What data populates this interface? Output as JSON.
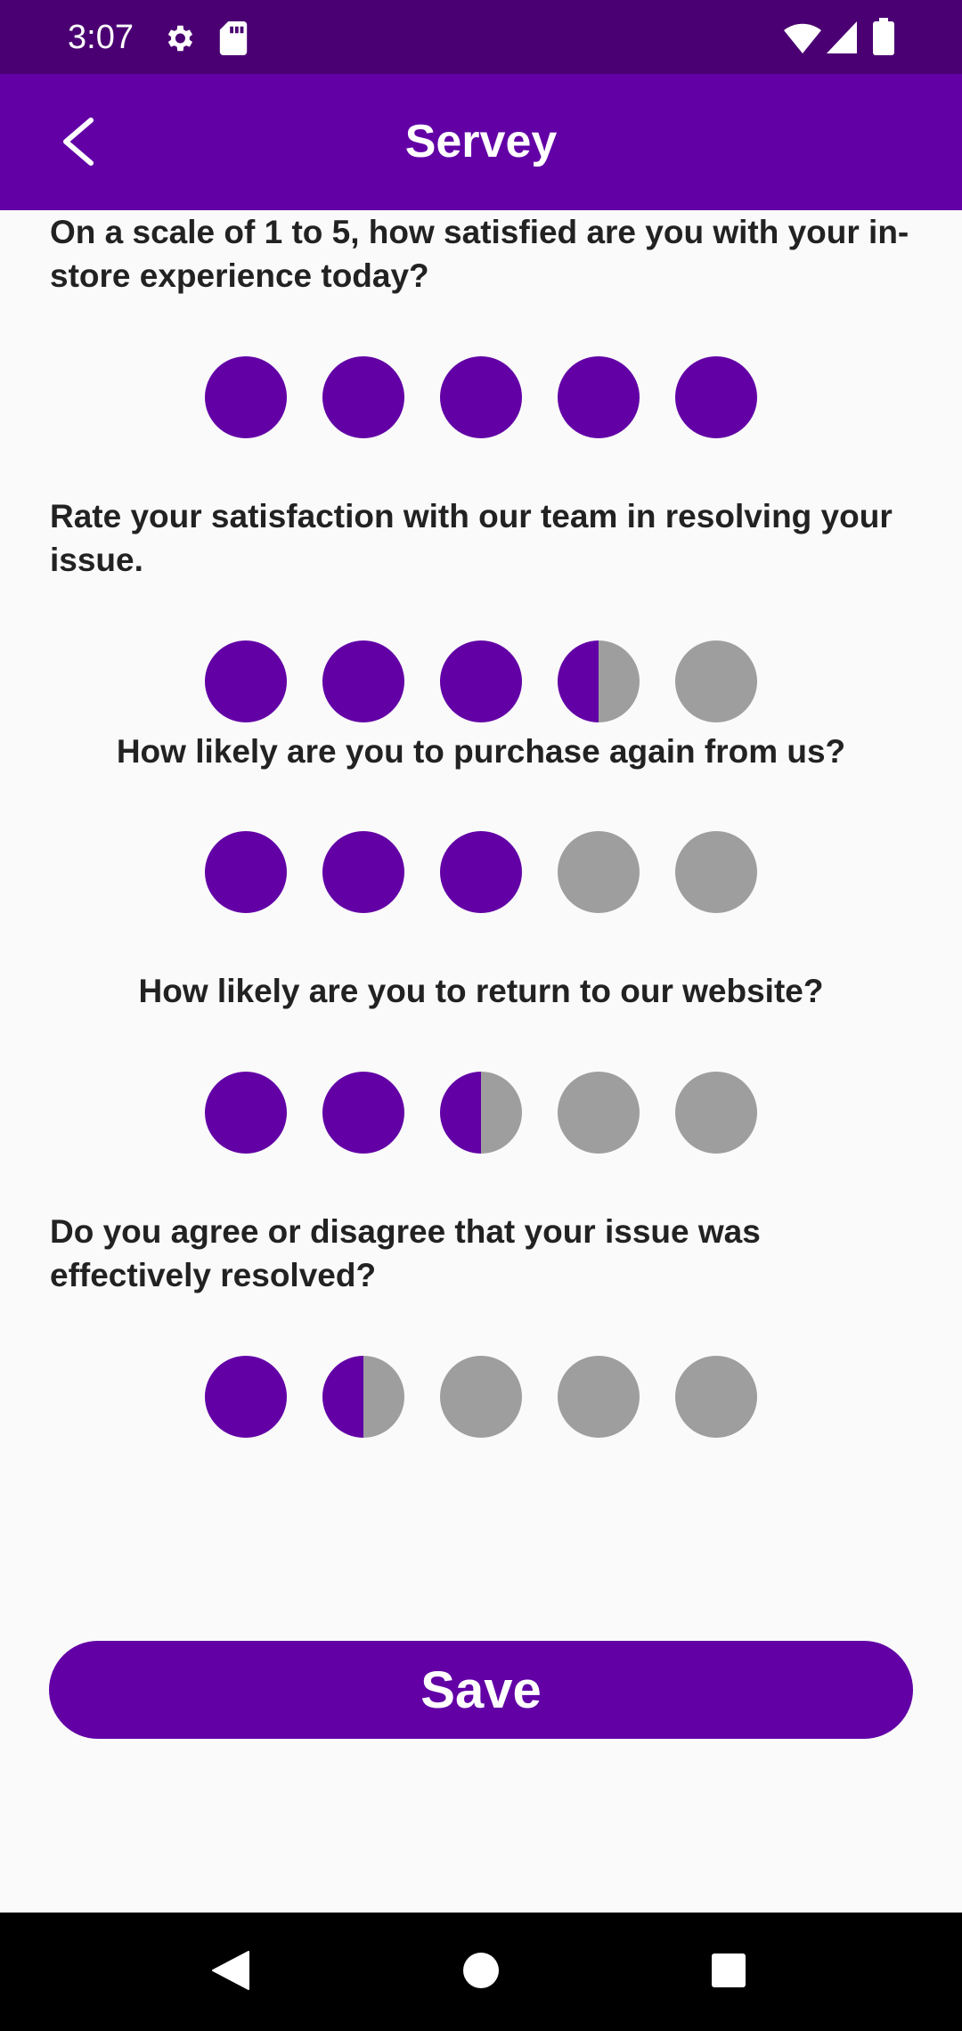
{
  "status_bar": {
    "time": "3:07",
    "icons": [
      "settings-icon",
      "sd-card-icon",
      "wifi-icon",
      "cell-signal-icon",
      "battery-icon"
    ]
  },
  "app_bar": {
    "title": "Servey",
    "back_icon": "arrow-back-icon"
  },
  "colors": {
    "status_bar": "#4a0072",
    "primary": "#6200a6",
    "inactive": "#9e9e9e",
    "background": "#fafafa",
    "text": "#222222"
  },
  "questions": [
    {
      "text": "On a scale of 1 to 5, how satisfied are you with your in-store experience today?",
      "rating": 5,
      "max": 5
    },
    {
      "text": "Rate your satisfaction with our team in resolving your issue.",
      "rating": 3.5,
      "max": 5
    },
    {
      "text": "How likely are you to purchase again from us?",
      "rating": 3,
      "max": 5
    },
    {
      "text": "How likely are you to return to our website?",
      "rating": 2.5,
      "max": 5
    },
    {
      "text": "Do you agree or disagree that your issue was effectively resolved?",
      "rating": 1.5,
      "max": 5
    }
  ],
  "save_label": "Save",
  "nav_bar": {
    "icons": [
      "back-triangle-icon",
      "home-circle-icon",
      "recents-square-icon"
    ]
  }
}
